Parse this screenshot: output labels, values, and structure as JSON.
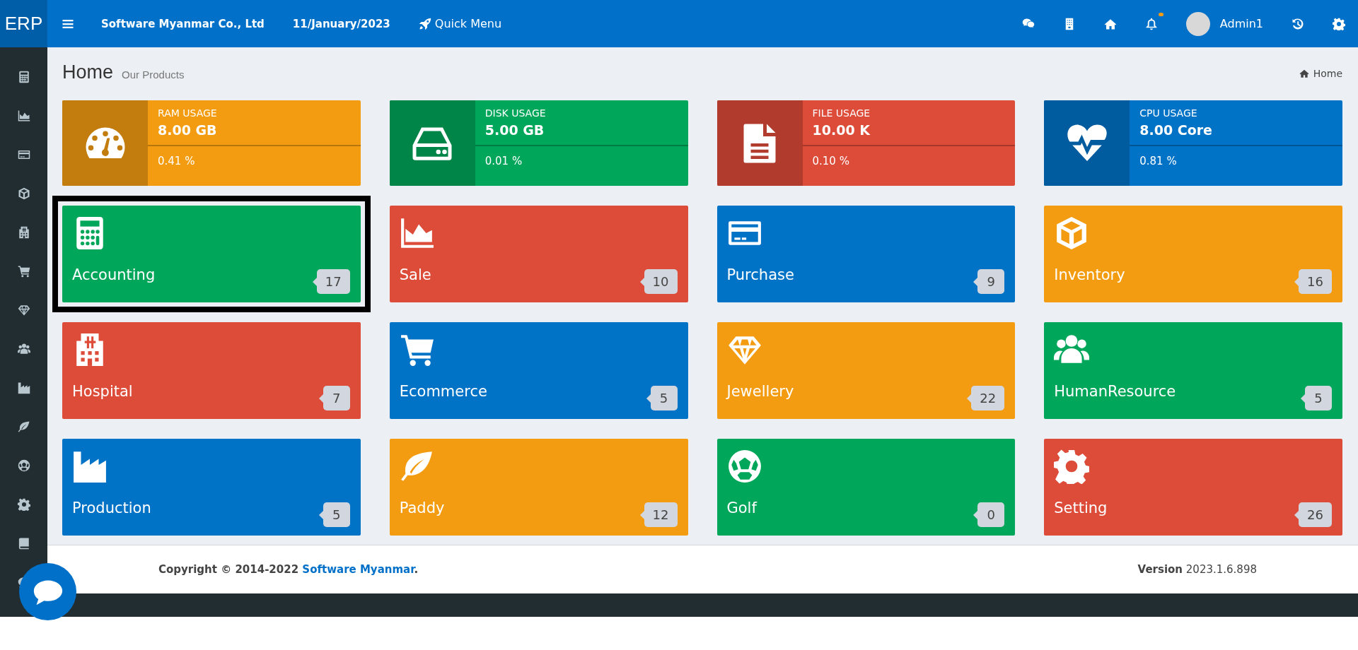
{
  "topbar": {
    "logo": "ERP",
    "company": "Software Myanmar Co., Ltd",
    "date": "11/January/2023",
    "quick_menu": "Quick Menu",
    "user": "Admin1",
    "notification_dot": true
  },
  "sidebar": {
    "items": [
      {
        "selected": false
      },
      {
        "selected": false
      },
      {
        "selected": false
      },
      {
        "selected": false
      },
      {
        "selected": false
      },
      {
        "selected": false
      },
      {
        "selected": false
      },
      {
        "selected": false
      },
      {
        "selected": false
      },
      {
        "selected": false
      },
      {
        "selected": false
      },
      {
        "selected": false
      },
      {
        "selected": false
      },
      {
        "selected": false
      }
    ]
  },
  "header": {
    "title": "Home",
    "subtitle": "Our Products",
    "breadcrumb": "Home"
  },
  "stats": [
    {
      "title": "RAM USAGE",
      "value": "8.00 GB",
      "percent": "0.41 %",
      "color": "#f39c12"
    },
    {
      "title": "DISK USAGE",
      "value": "5.00 GB",
      "percent": "0.01 %",
      "color": "#00a65a"
    },
    {
      "title": "FILE USAGE",
      "value": "10.00 K",
      "percent": "0.10 %",
      "color": "#dd4b39"
    },
    {
      "title": "CPU USAGE",
      "value": "8.00 Core",
      "percent": "0.81 %",
      "color": "#0073c7"
    }
  ],
  "modules": [
    {
      "label": "Accounting",
      "count": "17",
      "color": "#00a65a",
      "selected": true
    },
    {
      "label": "Sale",
      "count": "10",
      "color": "#dd4b39",
      "selected": false
    },
    {
      "label": "Purchase",
      "count": "9",
      "color": "#0073c7",
      "selected": false
    },
    {
      "label": "Inventory",
      "count": "16",
      "color": "#f39c12",
      "selected": false
    },
    {
      "label": "Hospital",
      "count": "7",
      "color": "#dd4b39",
      "selected": false
    },
    {
      "label": "Ecommerce",
      "count": "5",
      "color": "#0073c7",
      "selected": false
    },
    {
      "label": "Jewellery",
      "count": "22",
      "color": "#f39c12",
      "selected": false
    },
    {
      "label": "HumanResource",
      "count": "5",
      "color": "#00a65a",
      "selected": false
    },
    {
      "label": "Production",
      "count": "5",
      "color": "#0073c7",
      "selected": false
    },
    {
      "label": "Paddy",
      "count": "12",
      "color": "#f39c12",
      "selected": false
    },
    {
      "label": "Golf",
      "count": "0",
      "color": "#00a65a",
      "selected": false
    },
    {
      "label": "Setting",
      "count": "26",
      "color": "#dd4b39",
      "selected": false
    }
  ],
  "footer": {
    "copyright": "Copyright © 2014-2022 ",
    "company_link": "Software Myanmar",
    "end": ".",
    "version": "**Version** 2023.1.6.898"
  }
}
